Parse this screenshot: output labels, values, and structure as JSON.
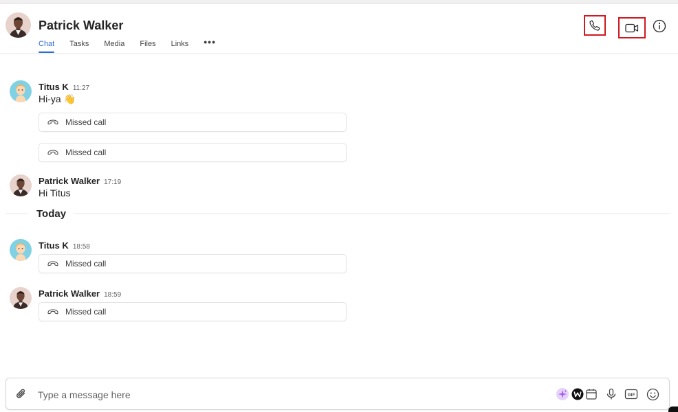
{
  "header": {
    "name": "Patrick Walker",
    "tabs": [
      {
        "label": "Chat",
        "active": true
      },
      {
        "label": "Tasks",
        "active": false
      },
      {
        "label": "Media",
        "active": false
      },
      {
        "label": "Files",
        "active": false
      },
      {
        "label": "Links",
        "active": false
      }
    ],
    "more_label": "•••",
    "actions": [
      "phone-icon",
      "video-camera-icon",
      "info-icon"
    ]
  },
  "messages": [
    {
      "sender": "Titus K",
      "time": "11:27",
      "text": "Hi-ya 👋",
      "missed_calls": [
        "Missed call",
        "Missed call"
      ]
    },
    {
      "sender": "Patrick Walker",
      "time": "17:19",
      "text": "Hi Titus"
    },
    {
      "sender": "Titus K",
      "time": "18:58",
      "missed_calls": [
        "Missed call"
      ]
    },
    {
      "sender": "Patrick Walker",
      "time": "18:59",
      "missed_calls": [
        "Missed call"
      ]
    }
  ],
  "day_divider": "Today",
  "composer": {
    "placeholder": "Type a message here",
    "icons": [
      "paperclip-icon",
      "ai-sparkle-icon",
      "w-logo-icon",
      "calendar-icon",
      "microphone-icon",
      "gif-icon",
      "emoji-icon"
    ]
  },
  "colors": {
    "accent": "#2b6cd4",
    "highlight_box": "#d0181f",
    "sparkle": "#a55ef0"
  }
}
